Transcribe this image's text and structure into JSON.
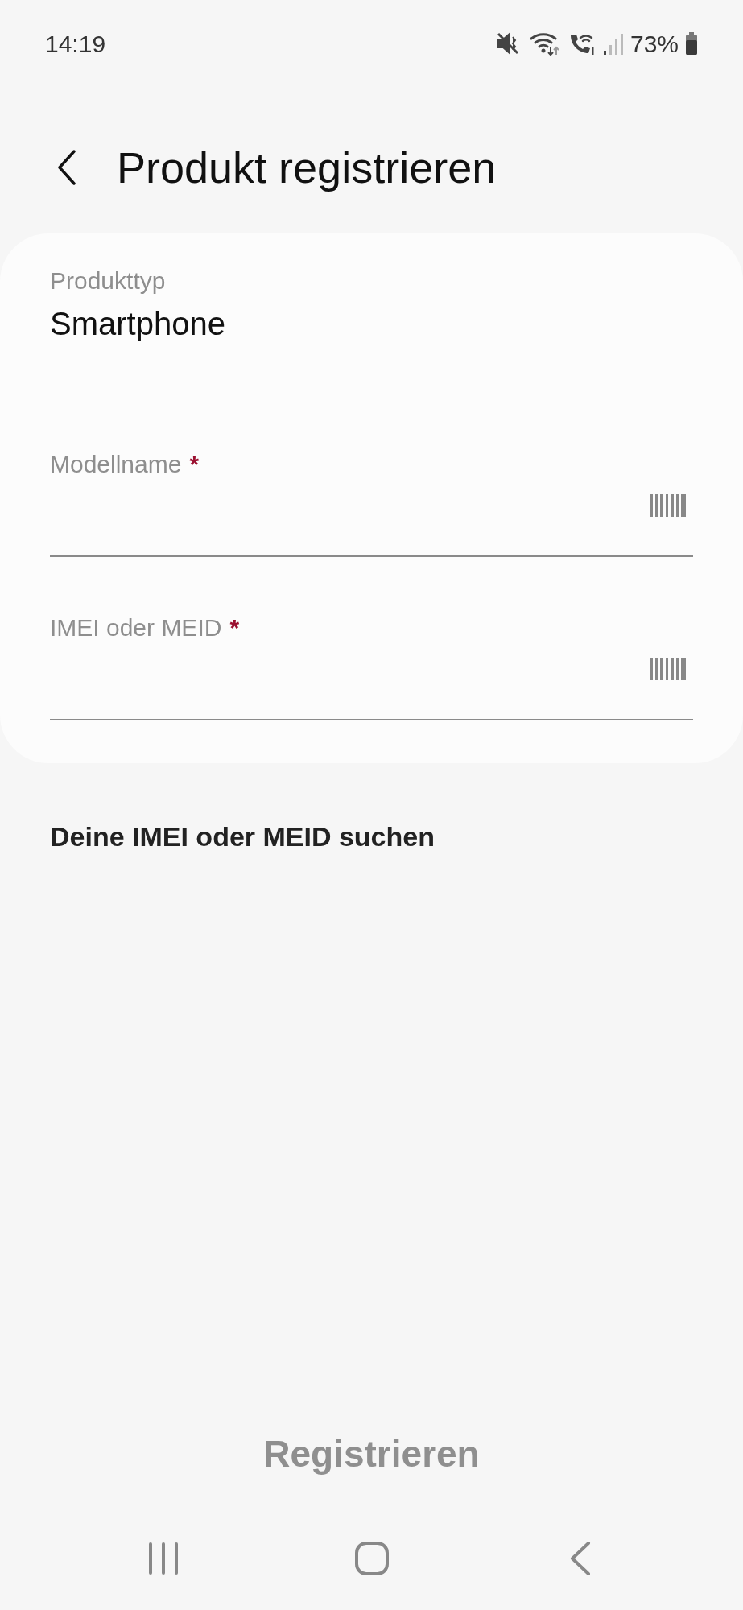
{
  "status_bar": {
    "time": "14:19",
    "battery": "73%"
  },
  "header": {
    "title": "Produkt registrieren"
  },
  "product_type": {
    "label": "Produkttyp",
    "value": "Smartphone"
  },
  "fields": [
    {
      "label": "Modellname",
      "required_mark": "*"
    },
    {
      "label": "IMEI oder MEID",
      "required_mark": "*"
    }
  ],
  "find_link": "Deine IMEI oder MEID suchen",
  "register_button": {
    "label": "Registrieren",
    "disabled": true
  }
}
